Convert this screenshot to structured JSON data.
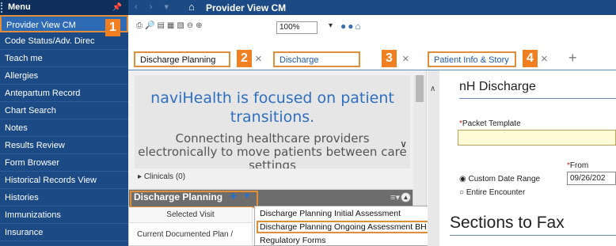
{
  "sidebar": {
    "header": "Menu",
    "pin_icon": "pin-icon",
    "items": [
      {
        "label": "Provider View CM",
        "selected": true
      },
      {
        "label": "Code Status/Adv. Direc"
      },
      {
        "label": "Teach me"
      },
      {
        "label": "Allergies"
      },
      {
        "label": "Antepartum Record"
      },
      {
        "label": "Chart Search"
      },
      {
        "label": "Notes"
      },
      {
        "label": "Results Review"
      },
      {
        "label": "Form Browser"
      },
      {
        "label": "Historical Records View"
      },
      {
        "label": "Histories"
      },
      {
        "label": "Immunizations"
      },
      {
        "label": "Insurance"
      }
    ]
  },
  "topbar": {
    "title": "Provider View CM",
    "icons": [
      "back-arrow-icon",
      "forward-arrow-icon",
      "dropdown-icon",
      "home-icon"
    ]
  },
  "toolbar": {
    "zoom": "100%",
    "icons": [
      "print-icon",
      "binoculars-icon",
      "copy-icon",
      "paste-icon",
      "zoom-out-icon",
      "zoom-in-icon",
      "circle-icon",
      "home-icon"
    ]
  },
  "tabs": [
    {
      "label": "Discharge Planning",
      "badge": "2"
    },
    {
      "label": "Discharge",
      "badge": "3"
    },
    {
      "label": "Patient Info & Story",
      "badge": "4"
    }
  ],
  "callout_badge_1": "1",
  "banner": {
    "headline": "naviHealth is focused on patient transitions.",
    "subtext": "Connecting healthcare providers electronically to move patients between care settings"
  },
  "clinicals": "Clinicals (0)",
  "discharge_panel": {
    "title": "Discharge Planning",
    "selected_visit": "Selected Visit",
    "current_plan": "Current Documented Plan /"
  },
  "dropdown_menu": {
    "options": [
      {
        "label": "Discharge Planning Initial Assessment"
      },
      {
        "label": "Discharge Planning Ongoing Assessment BH",
        "highlighted": true
      },
      {
        "label": "Regulatory Forms"
      }
    ]
  },
  "right_pane": {
    "title": "nH Discharge",
    "packet_template_label": "Packet Template",
    "from_label": "From",
    "radio_custom": "Custom Date Range",
    "radio_entire": "Entire Encounter",
    "date_value": "09/26/202",
    "sections_title": "Sections to Fax"
  },
  "colors": {
    "sidebar_bg": "#1b4a85",
    "highlight_orange": "#e08e3a",
    "badge_orange": "#f07f21",
    "link_blue": "#1f5aa8"
  }
}
